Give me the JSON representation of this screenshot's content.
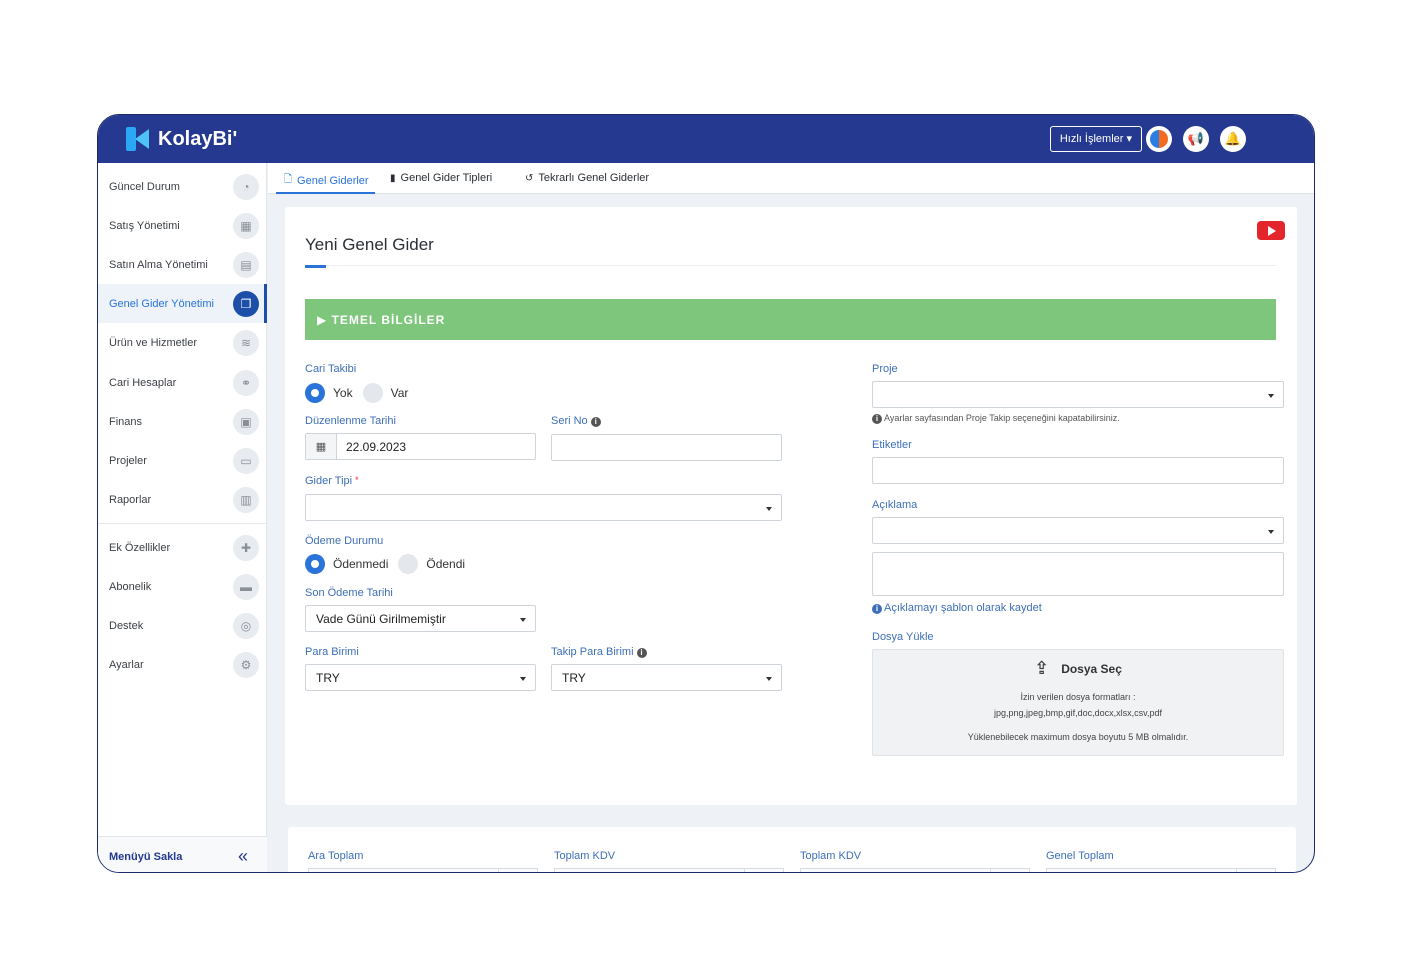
{
  "app": {
    "brand": "KolayBi'",
    "quick_actions": "Hızlı İşlemler ▾"
  },
  "sidebar": {
    "items": [
      {
        "label": "Güncel Durum",
        "icon": "dashboard-icon",
        "glyph": "◔"
      },
      {
        "label": "Satış Yönetimi",
        "icon": "calculator-icon",
        "glyph": "▦"
      },
      {
        "label": "Satın Alma Yönetimi",
        "icon": "document-icon",
        "glyph": "▤"
      },
      {
        "label": "Genel Gider Yönetimi",
        "icon": "copy-icon",
        "glyph": "❐"
      },
      {
        "label": "Ürün ve Hizmetler",
        "icon": "database-icon",
        "glyph": "≋"
      },
      {
        "label": "Cari Hesaplar",
        "icon": "handshake-icon",
        "glyph": "⚭"
      },
      {
        "label": "Finans",
        "icon": "money-icon",
        "glyph": "▣"
      },
      {
        "label": "Projeler",
        "icon": "folder-icon",
        "glyph": "▭"
      },
      {
        "label": "Raporlar",
        "icon": "bar-chart-icon",
        "glyph": "▥"
      },
      {
        "label": "Ek Özellikler",
        "icon": "puzzle-icon",
        "glyph": "✚"
      },
      {
        "label": "Abonelik",
        "icon": "credit-card-icon",
        "glyph": "▬"
      },
      {
        "label": "Destek",
        "icon": "lifebuoy-icon",
        "glyph": "◎"
      },
      {
        "label": "Ayarlar",
        "icon": "gears-icon",
        "glyph": "⚙"
      }
    ],
    "active_index": 3,
    "footer_label": "Menüyü Sakla",
    "footer_icon": "double-chevron-left-icon",
    "footer_glyph": "«"
  },
  "tabs": [
    {
      "label": "Genel Giderler",
      "icon": "file-icon",
      "glyph": "🗋"
    },
    {
      "label": "Genel Gider Tipleri",
      "icon": "file-solid-icon",
      "glyph": "▮"
    },
    {
      "label": "Tekrarlı Genel Giderler",
      "icon": "refresh-icon",
      "glyph": "↺"
    }
  ],
  "form": {
    "title": "Yeni Genel Gider",
    "section_title": "▶ TEMEL BİLGİLER",
    "cari_takibi": {
      "label": "Cari Takibi",
      "options": [
        "Yok",
        "Var"
      ],
      "selected": "Yok"
    },
    "duzenlenme_tarihi": {
      "label": "Düzenlenme Tarihi",
      "value": "22.09.2023"
    },
    "seri_no": {
      "label": "Seri No",
      "value": ""
    },
    "gider_tipi": {
      "label": "Gider Tipi",
      "required_mark": "*",
      "value": ""
    },
    "odeme_durumu": {
      "label": "Ödeme Durumu",
      "options": [
        "Ödenmedi",
        "Ödendi"
      ],
      "selected": "Ödenmedi"
    },
    "son_odeme_tarihi": {
      "label": "Son Ödeme Tarihi",
      "value": "Vade Günü Girilmemiştir"
    },
    "para_birimi": {
      "label": "Para Birimi",
      "value": "TRY"
    },
    "takip_para_birimi": {
      "label": "Takip Para Birimi",
      "value": "TRY"
    },
    "proje": {
      "label": "Proje",
      "value": "",
      "hint": "Ayarlar sayfasından Proje Takip seçeneğini kapatabilirsiniz."
    },
    "etiketler": {
      "label": "Etiketler",
      "value": ""
    },
    "aciklama": {
      "label": "Açıklama",
      "value": "",
      "template_link": "Açıklamayı şablon olarak kaydet"
    },
    "dosya_yukle": {
      "label": "Dosya Yükle",
      "button": "Dosya Seç",
      "formats_title": "İzin verilen dosya formatları :",
      "formats": "jpg,png,jpeg,bmp,gif,doc,docx,xlsx,csv,pdf",
      "max_size": "Yüklenebilecek maximum dosya boyutu 5 MB olmalıdır."
    }
  },
  "totals": {
    "labels": [
      "Ara Toplam",
      "Toplam KDV",
      "Toplam KDV",
      "Genel Toplam"
    ]
  },
  "colors": {
    "topbar": "#24398f",
    "accent": "#2a73d9",
    "section_green": "#7dc67b",
    "youtube_red": "#e3262b"
  }
}
